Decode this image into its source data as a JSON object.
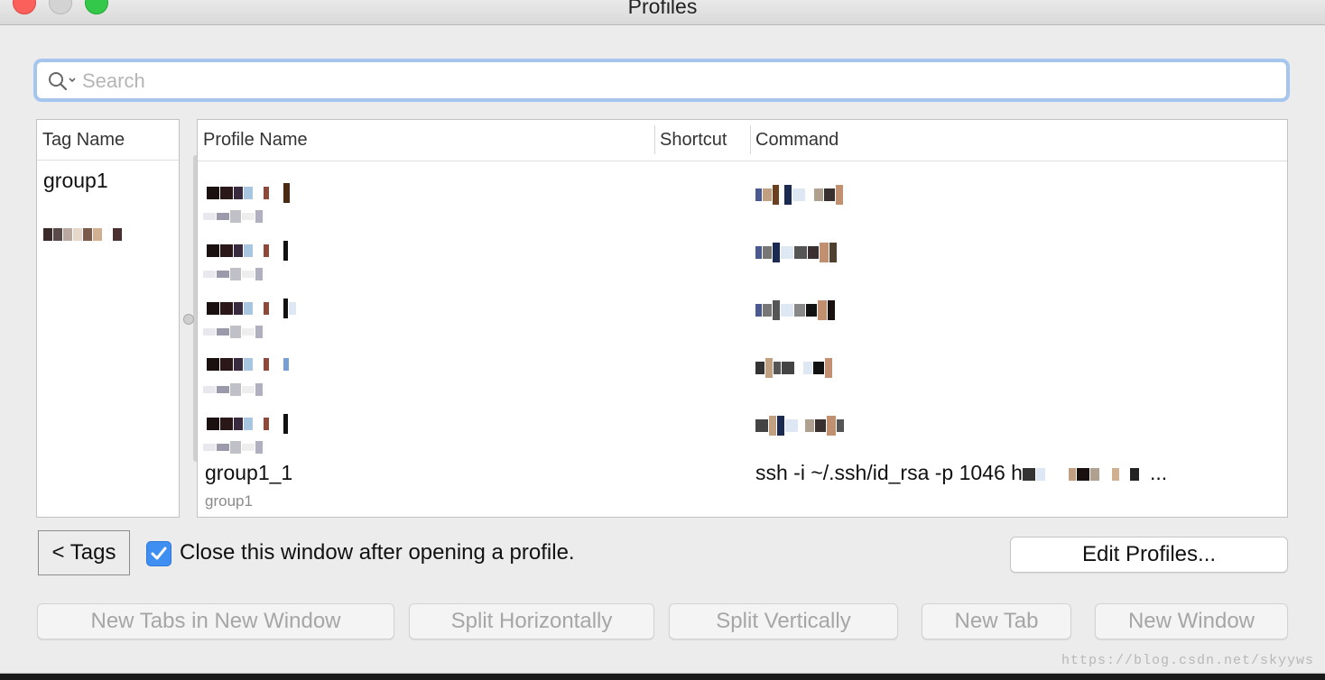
{
  "window": {
    "title": "Profiles"
  },
  "search": {
    "placeholder": "Search"
  },
  "tags": {
    "header": "Tag Name",
    "items": [
      {
        "label": "group1"
      }
    ]
  },
  "profiles": {
    "headers": {
      "name": "Profile Name",
      "shortcut": "Shortcut",
      "command": "Command"
    },
    "rows": [
      {
        "name": "group1_1",
        "tag": "group1",
        "command_prefix": "ssh -i ~/.ssh/id_rsa -p 1046 h",
        "command_suffix": "..."
      }
    ]
  },
  "footer": {
    "tags_button": "< Tags",
    "close_after_open": {
      "label": "Close this window after opening a profile.",
      "checked": true
    },
    "edit_profiles": "Edit Profiles...",
    "new_tabs_in_new_window": "New Tabs in New Window",
    "split_horizontally": "Split Horizontally",
    "split_vertically": "Split Vertically",
    "new_tab": "New Tab",
    "new_window": "New Window"
  },
  "watermark": "https://blog.csdn.net/skyyws",
  "colors": {
    "accent": "#3f8ef1",
    "focus_ring": "#a5c6ef",
    "close": "#fc605b",
    "zoom": "#34c84a"
  }
}
